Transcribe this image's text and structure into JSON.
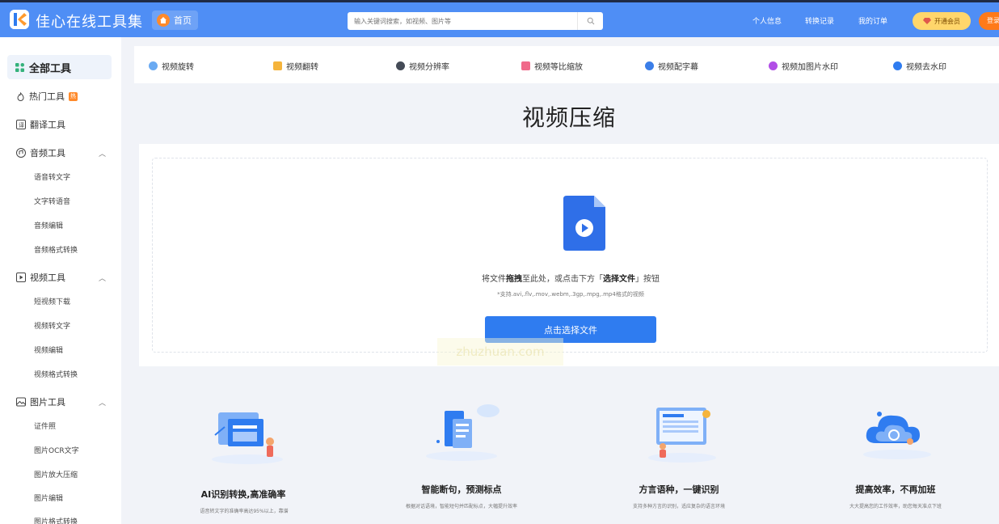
{
  "header": {
    "brand": "佳心在线工具集",
    "home": "首页",
    "search_placeholder": "输入关键词搜索，如视频、图片等",
    "links": [
      "个人信息",
      "转换记录",
      "我的订单"
    ],
    "vip": "开通会员",
    "login": "登录"
  },
  "sidebar": {
    "all_tools": "全部工具",
    "hot": "热门工具",
    "hot_badge": "热",
    "translate": "翻译工具",
    "audio": "音频工具",
    "audio_items": [
      "语音转文字",
      "文字转语音",
      "音频编辑",
      "音频格式转换"
    ],
    "video": "视频工具",
    "video_items": [
      "短视频下载",
      "视频转文字",
      "视频编辑",
      "视频格式转换"
    ],
    "image": "图片工具",
    "image_items": [
      "证件照",
      "图片OCR文字",
      "图片放大压缩",
      "图片编辑",
      "图片格式转换"
    ]
  },
  "toolbar": [
    "视频旋转",
    "视频翻转",
    "视频分辨率",
    "视频等比缩放",
    "视频配字幕",
    "视频加图片水印",
    "视频去水印"
  ],
  "main": {
    "title": "视频压缩",
    "drop_text_1": "将文件",
    "drop_text_bold1": "拖拽",
    "drop_text_2": "至此处，或点击下方「",
    "drop_text_bold2": "选择文件",
    "drop_text_3": "」按钮",
    "hint": "*支持.avi,.flv,.mov,.webm,.3gp,.mpg,.mp4格式的视频",
    "select_button": "点击选择文件",
    "watermark": "zhuzhuan.com"
  },
  "features": [
    {
      "title": "AI识别转换,高准确率",
      "desc": "语音转文字的准确率高达95%以上，靠谱"
    },
    {
      "title": "智能断句，预测标点",
      "desc": "根据对话语境，智能短句并匹配标点，大幅提升效率"
    },
    {
      "title": "方言语种，一键识别",
      "desc": "支持多种方言的识别，适应复杂的语言环境"
    },
    {
      "title": "提高效率，不再加班",
      "desc": "大大提高您的工作效率，助您每天准点下班"
    }
  ],
  "colors": {
    "header": "#4f8ef5",
    "accent": "#2f7cf0"
  }
}
